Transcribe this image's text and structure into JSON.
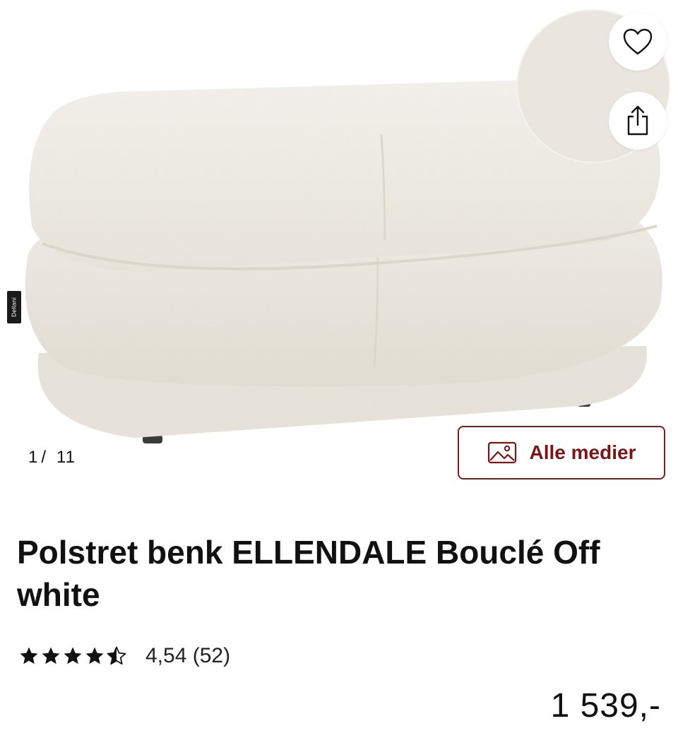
{
  "gallery": {
    "current": "1",
    "separator": "/",
    "total": "11",
    "brand_tag": "Dellani",
    "all_media_label": "Alle medier"
  },
  "product": {
    "title": "Polstret benk ELLENDALE Bouclé Off white",
    "rating_value": "4,54",
    "rating_count": "(52)",
    "rating_stars": 4.5,
    "price": "1 539,-"
  },
  "icons": {
    "wishlist": "heart-icon",
    "share": "share-icon",
    "media": "image-icon",
    "star": "star-icon"
  },
  "colors": {
    "accent": "#7a1515",
    "fabric": "#f2efe8"
  }
}
